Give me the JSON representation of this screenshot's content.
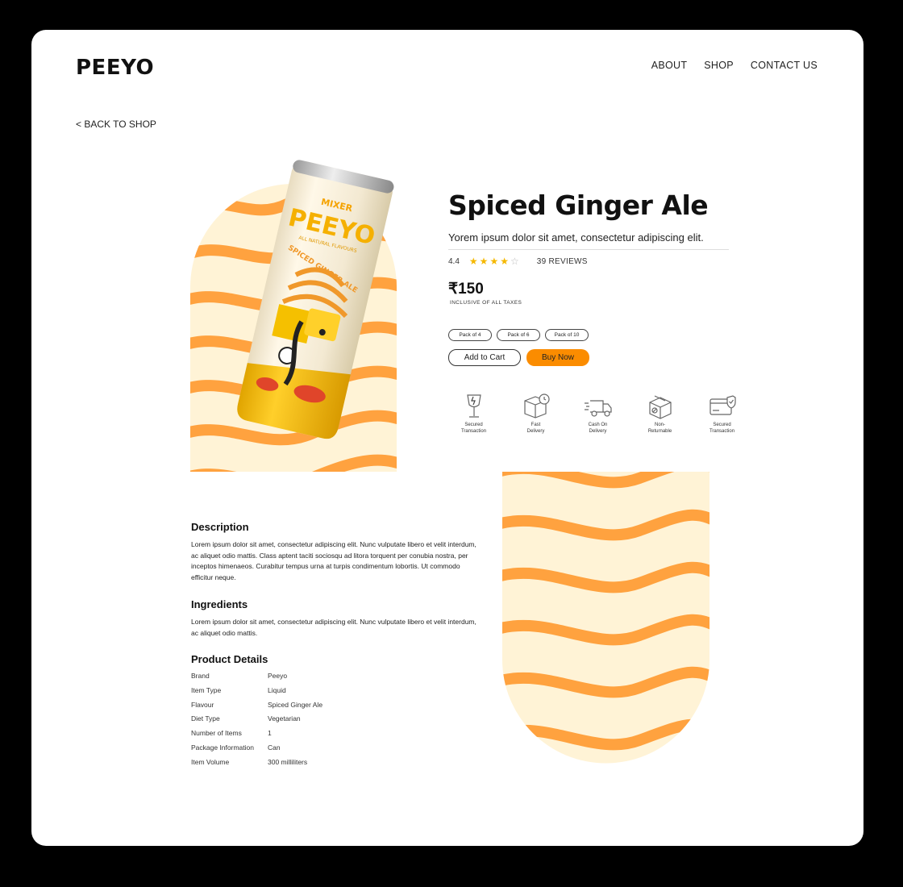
{
  "header": {
    "logo": "PEEYO",
    "nav": [
      "ABOUT",
      "SHOP",
      "CONTACT US"
    ]
  },
  "back_link": "< BACK TO SHOP",
  "can": {
    "mixer": "MIXER",
    "brand": "PEEYO",
    "tagline": "ALL NATURAL FLAVOURS",
    "flavour_text": "SPICED GINGER ALE"
  },
  "product": {
    "name": "Spiced Ginger Ale",
    "tagline": "Yorem ipsum dolor sit amet, consectetur adipiscing elit.",
    "rating": "4.4",
    "rating_value": 4,
    "rating_max": 5,
    "reviews": "39 REVIEWS",
    "price": "₹150",
    "price_note": "INCLUSIVE OF ALL TAXES",
    "packs": [
      "Pack of 4",
      "Pack of 6",
      "Pack of 10"
    ],
    "add_to_cart": "Add to Cart",
    "buy_now": "Buy Now"
  },
  "features": [
    {
      "icon": "glass-icon",
      "line1": "Secured",
      "line2": "Transaction"
    },
    {
      "icon": "box-clock-icon",
      "line1": "Fast",
      "line2": "Delivery"
    },
    {
      "icon": "delivery-truck-icon",
      "line1": "Cash On",
      "line2": "Delivery"
    },
    {
      "icon": "return-box-icon",
      "line1": "Non-",
      "line2": "Returnable"
    },
    {
      "icon": "secure-card-icon",
      "line1": "Secured",
      "line2": "Transaction"
    }
  ],
  "description": {
    "heading": "Description",
    "text": "Lorem ipsum dolor sit amet, consectetur adipiscing elit. Nunc vulputate libero et velit interdum, ac aliquet odio mattis. Class aptent taciti sociosqu ad litora torquent per conubia nostra, per inceptos himenaeos. Curabitur tempus urna at turpis condimentum lobortis. Ut commodo efficitur neque."
  },
  "ingredients": {
    "heading": "Ingredients",
    "text": "Lorem ipsum dolor sit amet, consectetur adipiscing elit. Nunc vulputate libero et velit interdum, ac aliquet odio mattis."
  },
  "details": {
    "heading": "Product Details",
    "rows": [
      {
        "key": "Brand",
        "value": "Peeyo"
      },
      {
        "key": "Item Type",
        "value": "Liquid"
      },
      {
        "key": "Flavour",
        "value": "Spiced Ginger Ale"
      },
      {
        "key": "Diet Type",
        "value": "Vegetarian"
      },
      {
        "key": "Number of Items",
        "value": "1"
      },
      {
        "key": "Package Information",
        "value": "Can"
      },
      {
        "key": "Item Volume",
        "value": "300 milliliters"
      }
    ]
  },
  "colors": {
    "accent": "#FB8C00",
    "stripe": "#FFA23F",
    "cream": "#FFF3D6",
    "star": "#F5B800"
  }
}
